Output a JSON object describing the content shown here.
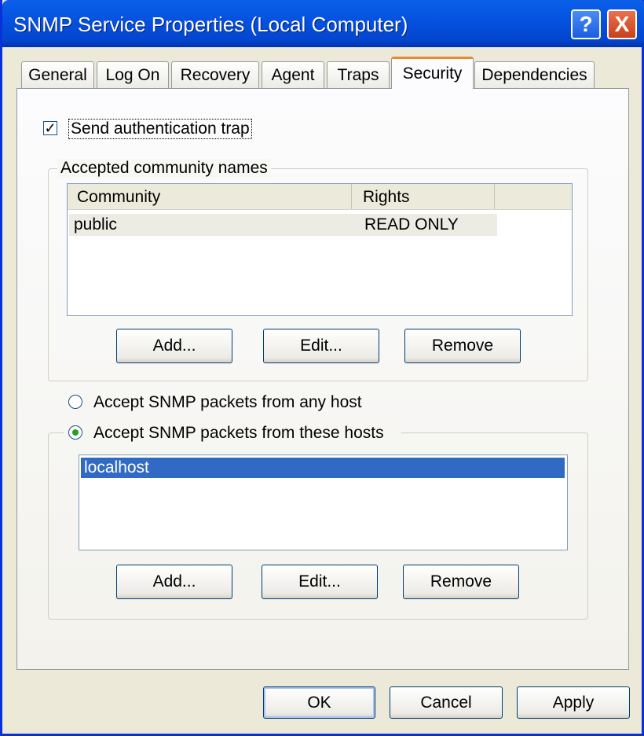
{
  "window": {
    "title": "SNMP Service Properties (Local Computer)",
    "help": "?",
    "close": "X"
  },
  "tabs": [
    {
      "label": "General"
    },
    {
      "label": "Log On"
    },
    {
      "label": "Recovery"
    },
    {
      "label": "Agent"
    },
    {
      "label": "Traps"
    },
    {
      "label": "Security",
      "active": true
    },
    {
      "label": "Dependencies"
    }
  ],
  "security": {
    "send_auth_trap": {
      "label": "Send authentication trap",
      "checked": true,
      "mark": "✓"
    },
    "community_group": {
      "legend": "Accepted community names",
      "columns": [
        "Community",
        "Rights"
      ],
      "rows": [
        {
          "community": "public",
          "rights": "READ ONLY"
        }
      ],
      "add": "Add...",
      "edit": "Edit...",
      "remove": "Remove"
    },
    "radio_any": {
      "label": "Accept SNMP packets from any host",
      "selected": false
    },
    "radio_these": {
      "label": "Accept SNMP packets from these hosts",
      "selected": true
    },
    "hosts": [
      "localhost"
    ],
    "hosts_add": "Add...",
    "hosts_edit": "Edit...",
    "hosts_remove": "Remove"
  },
  "footer": {
    "ok": "OK",
    "cancel": "Cancel",
    "apply": "Apply"
  },
  "colors": {
    "titlebar": "#0553e0",
    "selection": "#316ac5",
    "face": "#ece9d8"
  }
}
